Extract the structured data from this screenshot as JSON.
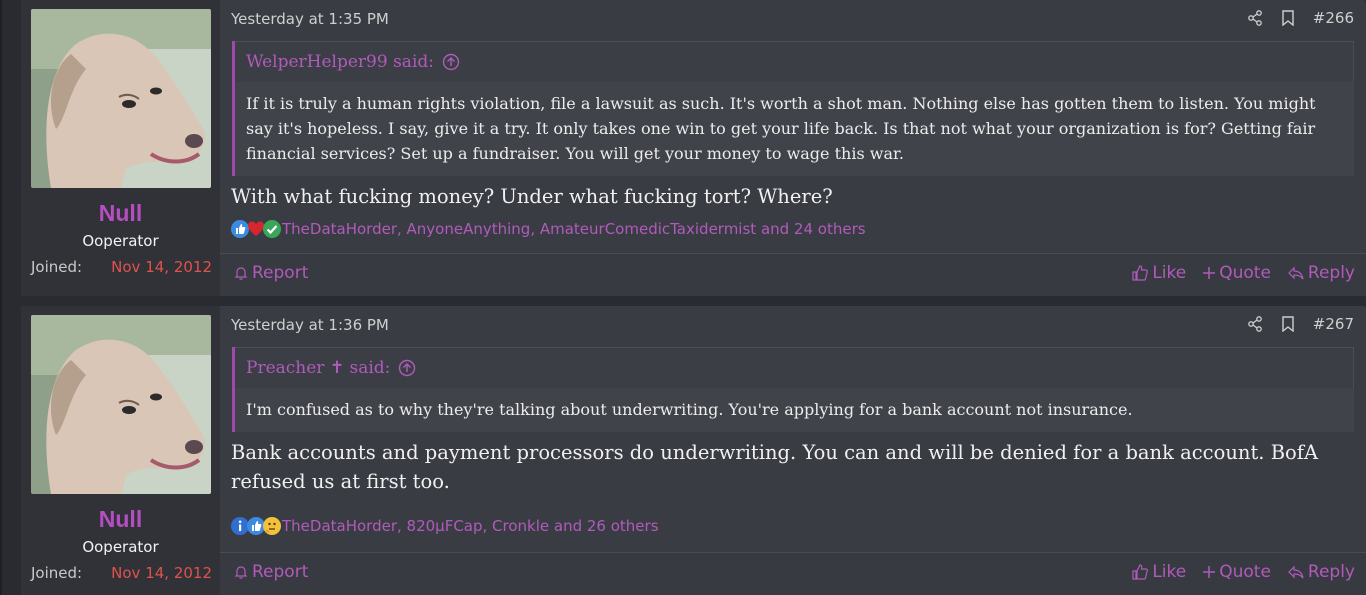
{
  "posts": [
    {
      "user": {
        "name": "Null",
        "title": "Ooperator",
        "joined_label": "Joined:",
        "joined_date": "Nov 14, 2012"
      },
      "date": "Yesterday at 1:35 PM",
      "post_number": "#266",
      "quote": {
        "author": "WelperHelper99 said:",
        "text": "If it is truly a human rights violation, file a lawsuit as such. It's worth a shot man. Nothing else has gotten them to listen. You might say it's hopeless. I say, give it a try. It only takes one win to get your life back. Is that not what your organization is for? Getting fair financial services? Set up a fundraiser. You will get your money to wage this war."
      },
      "message": "With what fucking money? Under what fucking tort? Where?",
      "reactions": {
        "icons": [
          "like-icon",
          "heart-icon",
          "check-icon"
        ],
        "text": "TheDataHorder, AnyoneAnything, AmateurComedicTaxidermist and 24 others"
      },
      "footer": {
        "report": "Report",
        "like": "Like",
        "quote": "Quote",
        "reply": "Reply"
      }
    },
    {
      "user": {
        "name": "Null",
        "title": "Ooperator",
        "joined_label": "Joined:",
        "joined_date": "Nov 14, 2012"
      },
      "date": "Yesterday at 1:36 PM",
      "post_number": "#267",
      "quote": {
        "author": "Preacher ✝ said:",
        "text": "I'm confused as to why they're talking about underwriting. You're applying for a bank account not insurance."
      },
      "message": "Bank accounts and payment processors do underwriting. You can and will be denied for a bank account. BofA refused us at first too.",
      "reactions": {
        "icons": [
          "info-icon",
          "like-icon",
          "thinking-icon"
        ],
        "text": "TheDataHorder, 820µFCap, Cronkle and 26 others"
      },
      "footer": {
        "report": "Report",
        "like": "Like",
        "quote": "Quote",
        "reply": "Reply"
      }
    }
  ],
  "colors": {
    "accent": "#b05bbb",
    "username": "#b64ec2",
    "joined_date": "#e0524b",
    "post_bg": "#3a3c43"
  }
}
